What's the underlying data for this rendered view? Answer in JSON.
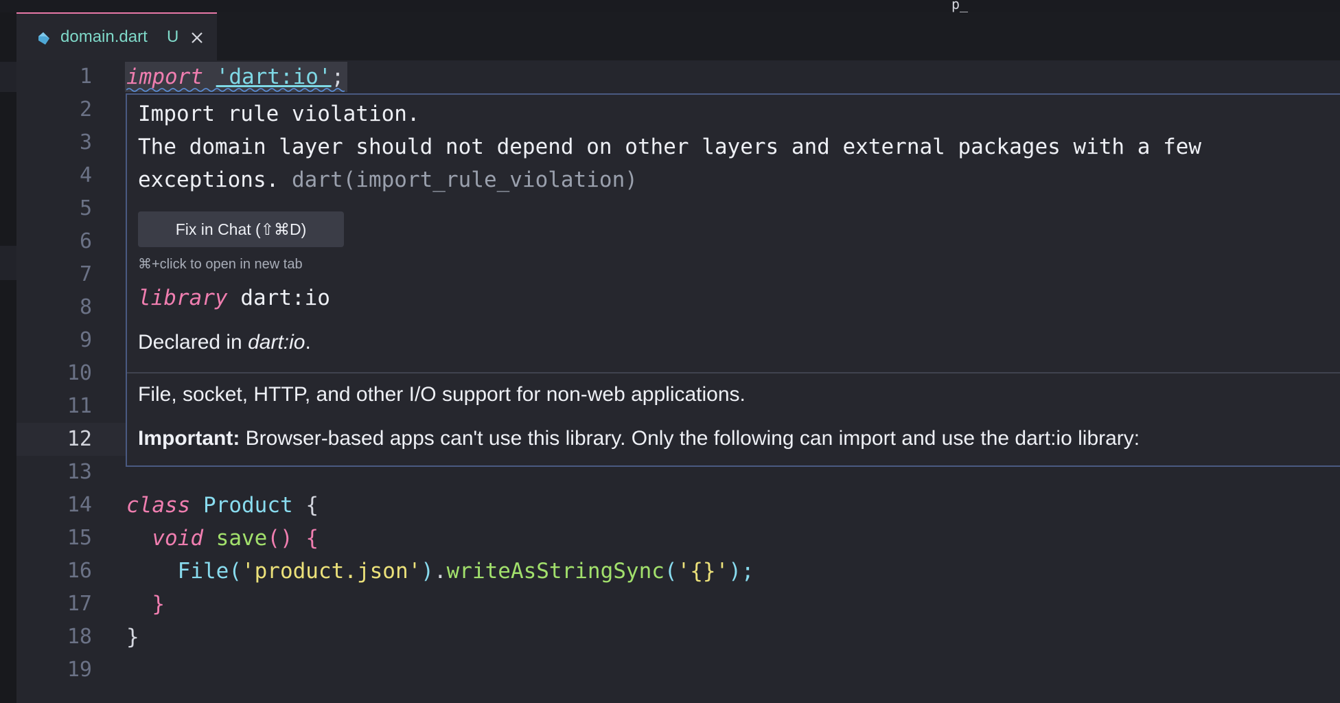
{
  "top_fragment": "p_",
  "tab": {
    "title": "domain.dart",
    "status": "U",
    "close_icon": "close-icon",
    "file_icon": "dart-file-icon"
  },
  "line_numbers": [
    "1",
    "2",
    "3",
    "4",
    "5",
    "6",
    "7",
    "8",
    "9",
    "10",
    "11",
    "12",
    "13",
    "14",
    "15",
    "16",
    "17",
    "18",
    "19"
  ],
  "active_line": "12",
  "code": {
    "line1": {
      "keyword": "import",
      "path": "'dart:io'",
      "end": ";"
    },
    "line14": {
      "keyword": "class",
      "name": "Product",
      "open": "{"
    },
    "line15": {
      "keyword": "void",
      "name": "save",
      "parens": "()",
      "open": "{"
    },
    "line16": {
      "cls": "File",
      "p1": "(",
      "arg": "'product.json'",
      "p2": ")",
      "dot": ".",
      "method": "writeAsStringSync",
      "p3": "(",
      "arg2": "'{}'",
      "p4": ");"
    },
    "line17": {
      "close": "}"
    },
    "line18": {
      "close": "}"
    }
  },
  "hover": {
    "title": "Import rule violation.",
    "message_line1": "The domain layer should not depend on other layers and external packages with a few",
    "message_line2": "exceptions.",
    "rule_code": "dart(import_rule_violation)",
    "fix_button": "Fix in Chat (⇧⌘D)",
    "hint": "⌘+click to open in new tab",
    "lib_keyword": "library",
    "lib_name": "dart:io",
    "declared_prefix": "Declared in ",
    "declared_name": "dart:io",
    "declared_suffix": ".",
    "description": "File, socket, HTTP, and other I/O support for non-web applications.",
    "important_label": "Important:",
    "important_text": " Browser-based apps can't use this library. Only the following can import and use the dart:io library:"
  },
  "colors": {
    "keyword": "#f07eb0",
    "string": "#ece17a",
    "class": "#89dcef",
    "function": "#a2e06c",
    "tab_accent": "#e879a8",
    "hover_border": "#4a5a82"
  }
}
